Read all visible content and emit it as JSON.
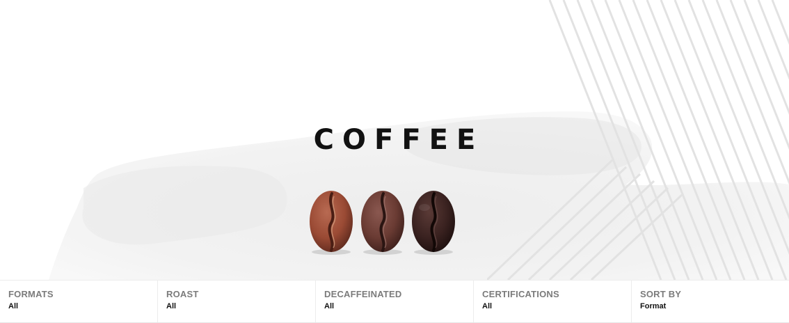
{
  "hero": {
    "title": "COFFEE",
    "image": "coffee-beans-three-roasts"
  },
  "filters": [
    {
      "label": "FORMATS",
      "value": "All"
    },
    {
      "label": "ROAST",
      "value": "All"
    },
    {
      "label": "DECAFFEINATED",
      "value": "All"
    },
    {
      "label": "CERTIFICATIONS",
      "value": "All"
    },
    {
      "label": "SORT BY",
      "value": "Format"
    }
  ],
  "colors": {
    "title": "#111111",
    "filter_label": "#7b7b7b",
    "filter_value": "#111111",
    "bean_light": "#9a4a34",
    "bean_medium": "#6a3b33",
    "bean_dark": "#3a2220"
  }
}
